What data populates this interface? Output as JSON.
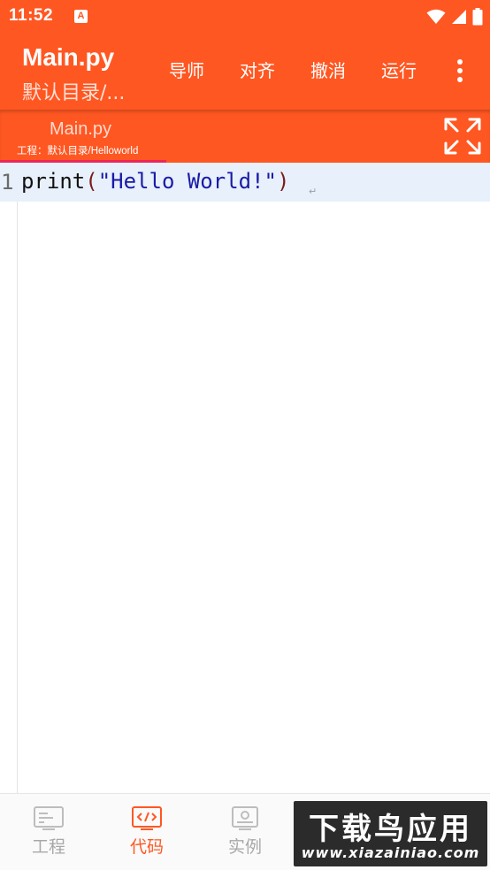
{
  "status_bar": {
    "time": "11:52",
    "notification_glyph": "A",
    "icons": [
      "wifi-icon",
      "signal-icon",
      "battery-icon"
    ]
  },
  "app_bar": {
    "title": "Main.py",
    "subtitle": "默认目录/...",
    "actions": [
      "导师",
      "对齐",
      "撤消",
      "运行"
    ],
    "more_icon": "more-vert-icon"
  },
  "file_tab": {
    "file_name": "Main.py",
    "project_path": "工程：默认目录/Helloworld",
    "fullscreen_icon": "fullscreen-icon"
  },
  "editor": {
    "line_number": "1",
    "code": {
      "function": "print",
      "open_paren": "(",
      "string": "\"Hello World!\"",
      "close_paren": ")"
    },
    "eol_glyph": "↵"
  },
  "bottom_nav": {
    "items": [
      {
        "label": "工程",
        "icon": "project-icon",
        "active": false
      },
      {
        "label": "代码",
        "icon": "code-icon",
        "active": true
      },
      {
        "label": "实例",
        "icon": "examples-icon",
        "active": false
      }
    ]
  },
  "watermark": {
    "main_text": "下载鸟应用",
    "sub_text": "www.xiazainiao.com"
  },
  "colors": {
    "primary": "#ff5722",
    "string": "#1a1aa6",
    "current_line": "#e7f0fb",
    "inactive_nav": "#a8a8a8"
  }
}
